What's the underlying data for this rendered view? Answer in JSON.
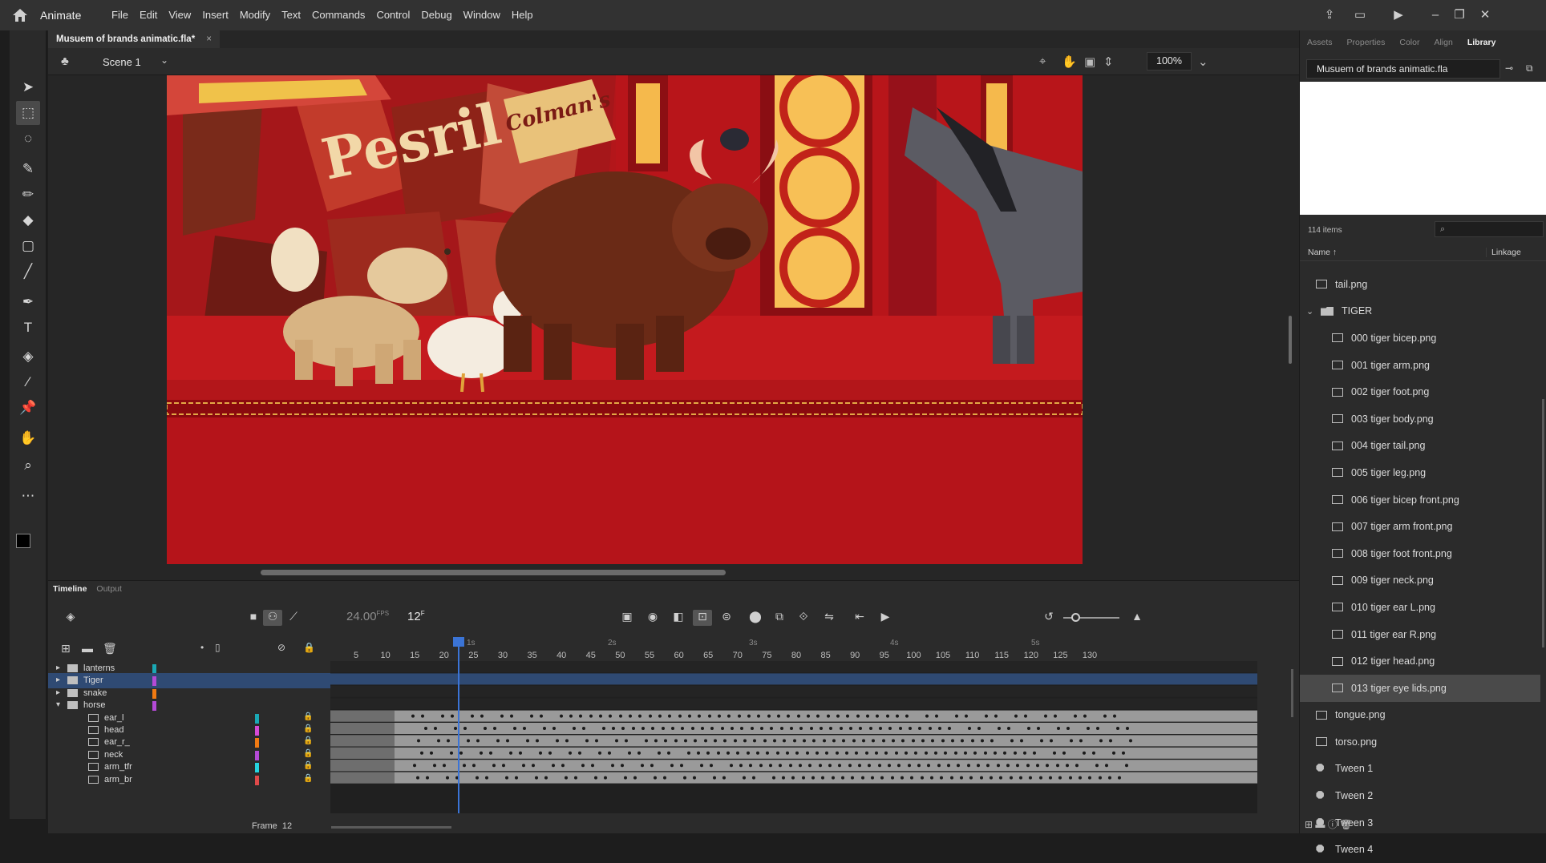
{
  "app": {
    "name": "Animate",
    "menus": [
      "File",
      "Edit",
      "View",
      "Insert",
      "Modify",
      "Text",
      "Commands",
      "Control",
      "Debug",
      "Window",
      "Help"
    ]
  },
  "document": {
    "tab_title": "Musuem of brands animatic.fla*",
    "close_glyph": "×"
  },
  "scene": {
    "name": "Scene 1",
    "zoom": "100%"
  },
  "stage": {
    "poster_text": "Pesril",
    "box_text": "Colman's"
  },
  "right_panel": {
    "tabs": [
      "Assets",
      "Properties",
      "Color",
      "Align",
      "Library"
    ],
    "active_tab": "Library",
    "library_name": "Musuem of brands animatic.fla",
    "item_count": "114 items",
    "col_name": "Name ↑",
    "col_linkage": "Linkage",
    "items": [
      {
        "label": "tail.png",
        "type": "bitmap",
        "indent": 0
      },
      {
        "label": "TIGER",
        "type": "folder",
        "indent": 0
      },
      {
        "label": "000 tiger bicep.png",
        "type": "bitmap",
        "indent": 1
      },
      {
        "label": "001 tiger arm.png",
        "type": "bitmap",
        "indent": 1
      },
      {
        "label": "002 tiger foot.png",
        "type": "bitmap",
        "indent": 1
      },
      {
        "label": "003 tiger body.png",
        "type": "bitmap",
        "indent": 1
      },
      {
        "label": "004 tiger tail.png",
        "type": "bitmap",
        "indent": 1
      },
      {
        "label": "005 tiger leg.png",
        "type": "bitmap",
        "indent": 1
      },
      {
        "label": "006 tiger bicep front.png",
        "type": "bitmap",
        "indent": 1
      },
      {
        "label": "007 tiger arm front.png",
        "type": "bitmap",
        "indent": 1
      },
      {
        "label": "008 tiger foot front.png",
        "type": "bitmap",
        "indent": 1
      },
      {
        "label": "009 tiger neck.png",
        "type": "bitmap",
        "indent": 1
      },
      {
        "label": "010 tiger ear L.png",
        "type": "bitmap",
        "indent": 1
      },
      {
        "label": "011 tiger ear R.png",
        "type": "bitmap",
        "indent": 1
      },
      {
        "label": "012 tiger head.png",
        "type": "bitmap",
        "indent": 1
      },
      {
        "label": "013 tiger eye lids.png",
        "type": "bitmap",
        "indent": 1,
        "selected": true
      },
      {
        "label": "tongue.png",
        "type": "bitmap",
        "indent": 0
      },
      {
        "label": "torso.png",
        "type": "bitmap",
        "indent": 0
      },
      {
        "label": "Tween 1",
        "type": "tween",
        "indent": 0
      },
      {
        "label": "Tween 2",
        "type": "tween",
        "indent": 0
      },
      {
        "label": "Tween 3",
        "type": "tween",
        "indent": 0
      },
      {
        "label": "Tween 4",
        "type": "tween",
        "indent": 0
      }
    ]
  },
  "timeline": {
    "tabs": [
      "Timeline",
      "Output"
    ],
    "fps": "24.00",
    "fps_unit": "FPS",
    "current_frame": "12",
    "frame_unit": "F",
    "frame_tip_label": "Frame",
    "frame_tip_value": "12",
    "ruler_ticks": [
      "5",
      "10",
      "15",
      "20",
      "25",
      "30",
      "35",
      "40",
      "45",
      "50",
      "55",
      "60",
      "65",
      "70",
      "75",
      "80",
      "85",
      "90",
      "95",
      "100",
      "105",
      "110",
      "115",
      "120",
      "125",
      "130"
    ],
    "seconds": [
      "1s",
      "2s",
      "3s",
      "4s",
      "5s"
    ],
    "layers": [
      {
        "name": "lanterns",
        "kind": "folder",
        "color": "#1aa9b5",
        "indent": 0
      },
      {
        "name": "Tiger",
        "kind": "folder",
        "color": "#b44ad6",
        "indent": 0,
        "selected": true
      },
      {
        "name": "snake",
        "kind": "folder",
        "color": "#f07a12",
        "indent": 0
      },
      {
        "name": "horse",
        "kind": "folder-open",
        "color": "#b44ad6",
        "indent": 0
      },
      {
        "name": "ear_l",
        "kind": "layer",
        "color": "#1aa9b5",
        "indent": 1
      },
      {
        "name": "head",
        "kind": "layer",
        "color": "#d64ad6",
        "indent": 1
      },
      {
        "name": "ear_r_",
        "kind": "layer",
        "color": "#f07a12",
        "indent": 1
      },
      {
        "name": "neck",
        "kind": "layer",
        "color": "#b44ad6",
        "indent": 1
      },
      {
        "name": "arm_tfr",
        "kind": "layer",
        "color": "#25d4e0",
        "indent": 1
      },
      {
        "name": "arm_br",
        "kind": "layer",
        "color": "#e04a4a",
        "indent": 1
      }
    ]
  }
}
